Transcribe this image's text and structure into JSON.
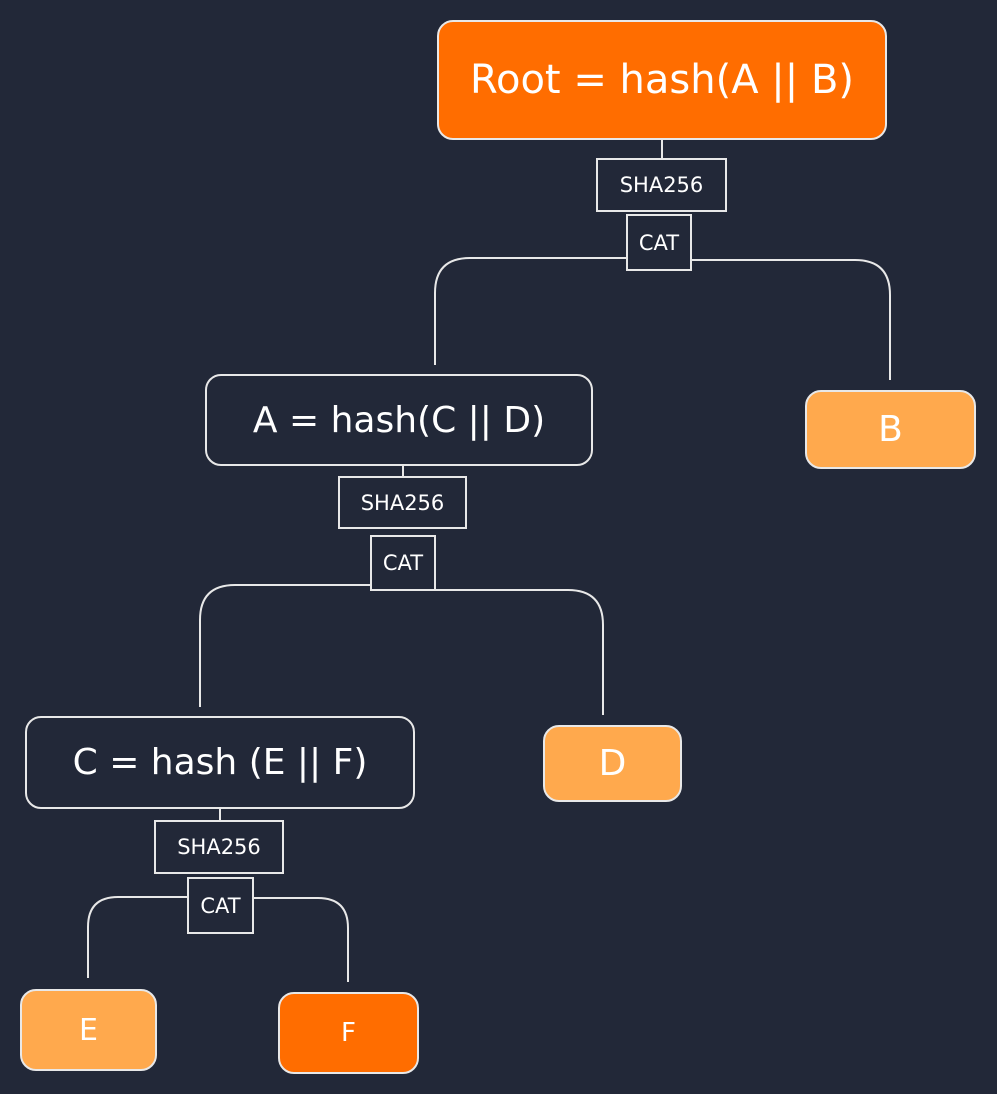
{
  "colors": {
    "background": "#222838",
    "root_fill": "#FF6D00",
    "leaf_fill": "#FFA94D",
    "stroke": "#e8e8e8"
  },
  "nodes": {
    "root": "Root = hash(A || B)",
    "a": "A = hash(C || D)",
    "b": "B",
    "c": "C = hash (E || F)",
    "d": "D",
    "e": "E",
    "f": "F"
  },
  "ops": {
    "sha": "SHA256",
    "cat": "CAT"
  }
}
